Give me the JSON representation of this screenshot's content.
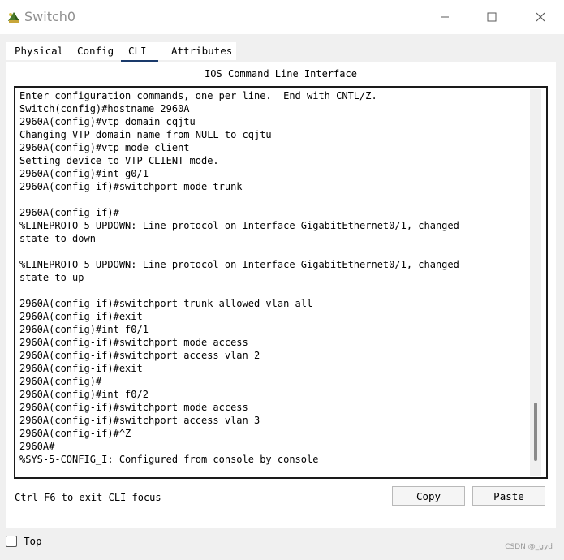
{
  "window": {
    "title": "Switch0",
    "icon": "switch-device-icon",
    "controls": [
      "minimize-icon",
      "maximize-icon",
      "close-icon"
    ]
  },
  "tabs": [
    {
      "label": "Physical",
      "active": false
    },
    {
      "label": "Config",
      "active": false
    },
    {
      "label": "CLI",
      "active": true
    },
    {
      "label": "Attributes",
      "active": false
    }
  ],
  "cli": {
    "header": "IOS Command Line Interface",
    "lines": [
      "Enter configuration commands, one per line.  End with CNTL/Z.",
      "Switch(config)#hostname 2960A",
      "2960A(config)#vtp domain cqjtu",
      "Changing VTP domain name from NULL to cqjtu",
      "2960A(config)#vtp mode client",
      "Setting device to VTP CLIENT mode.",
      "2960A(config)#int g0/1",
      "2960A(config-if)#switchport mode trunk",
      "",
      "2960A(config-if)#",
      "%LINEPROTO-5-UPDOWN: Line protocol on Interface GigabitEthernet0/1, changed",
      "state to down",
      "",
      "%LINEPROTO-5-UPDOWN: Line protocol on Interface GigabitEthernet0/1, changed",
      "state to up",
      "",
      "2960A(config-if)#switchport trunk allowed vlan all",
      "2960A(config-if)#exit",
      "2960A(config)#int f0/1",
      "2960A(config-if)#switchport mode access",
      "2960A(config-if)#switchport access vlan 2",
      "2960A(config-if)#exit",
      "2960A(config)#",
      "2960A(config)#int f0/2",
      "2960A(config-if)#switchport mode access",
      "2960A(config-if)#switchport access vlan 3",
      "2960A(config-if)#^Z",
      "2960A#",
      "%SYS-5-CONFIG_I: Configured from console by console"
    ],
    "focus_hint": "Ctrl+F6 to exit CLI focus",
    "copy_label": "Copy",
    "paste_label": "Paste"
  },
  "footer": {
    "top_label": "Top",
    "top_checked": false,
    "watermark": "CSDN @_gyd"
  },
  "colors": {
    "frame_bg": "#f0f0f0",
    "active_tab_underline": "#1a3a6b",
    "title_text": "#8f8f8f"
  }
}
